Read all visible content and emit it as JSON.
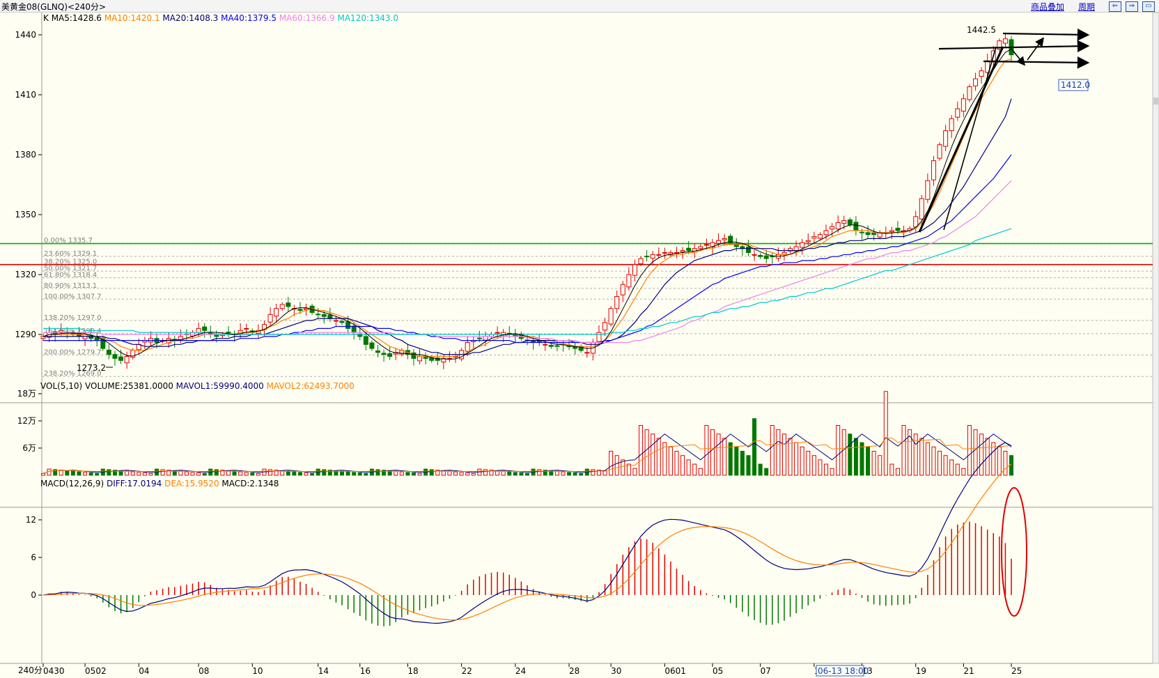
{
  "header": {
    "title": "美黄金08(GLNQ)<240分>",
    "links": [
      "商品叠加",
      "周期"
    ],
    "buttons": [
      "⇐",
      "⇒",
      "▭"
    ]
  },
  "chart_data": [
    {
      "type": "candlestick",
      "panel": "price",
      "legend_prefix": "K",
      "legend": [
        {
          "name": "MA5",
          "value": "1428.6",
          "color": "#000000"
        },
        {
          "name": "MA10",
          "value": "1420.1",
          "color": "#ff8000"
        },
        {
          "name": "MA20",
          "value": "1408.3",
          "color": "#000080"
        },
        {
          "name": "MA40",
          "value": "1379.5",
          "color": "#0000ff"
        },
        {
          "name": "MA60",
          "value": "1366.9",
          "color": "#ee82ee"
        },
        {
          "name": "MA120",
          "value": "1343.0",
          "color": "#00c8d0"
        }
      ],
      "y_ticks": [
        1440,
        1410,
        1380,
        1350,
        1320,
        1290
      ],
      "ylim": [
        1255,
        1451
      ],
      "price_label_high": "1442.5",
      "price_label_low": "1273.2",
      "current_price_tag": "1412.0",
      "fib_levels": [
        {
          "label": "0.00% 1335.7",
          "value": 1335.7
        },
        {
          "label": "23.60% 1329.1",
          "value": 1329.1
        },
        {
          "label": "38.20% 1325.0",
          "value": 1325.0
        },
        {
          "label": "50.00% 1321.7",
          "value": 1321.7
        },
        {
          "label": "61.80% 1318.4",
          "value": 1318.4
        },
        {
          "label": "80.90% 1313.1",
          "value": 1313.1
        },
        {
          "label": "100.00% 1307.7",
          "value": 1307.7
        },
        {
          "label": "138.20% 1297.0",
          "value": 1297.0
        },
        {
          "label": "161.80% 1290.4",
          "value": 1290.4
        },
        {
          "label": "200.00% 1279.7",
          "value": 1279.7
        },
        {
          "label": "238.20% 1269.0",
          "value": 1269.0
        }
      ],
      "hlines": [
        {
          "value": 1335.5,
          "color": "#00b000"
        },
        {
          "value": 1325.0,
          "color": "#d00000"
        }
      ],
      "close": [
        1289,
        1291,
        1290,
        1292,
        1291,
        1290,
        1289,
        1290,
        1288,
        1287,
        1283,
        1280,
        1278,
        1277,
        1279,
        1282,
        1285,
        1287,
        1288,
        1286,
        1287,
        1288,
        1287,
        1289,
        1290,
        1291,
        1293,
        1292,
        1290,
        1289,
        1290,
        1291,
        1290,
        1292,
        1293,
        1291,
        1292,
        1295,
        1300,
        1303,
        1305,
        1304,
        1303,
        1302,
        1303,
        1301,
        1300,
        1299,
        1298,
        1297,
        1296,
        1293,
        1291,
        1289,
        1285,
        1283,
        1281,
        1280,
        1279,
        1281,
        1282,
        1280,
        1278,
        1279,
        1278,
        1277,
        1277,
        1278,
        1278,
        1279,
        1282,
        1286,
        1287,
        1288,
        1289,
        1290,
        1291,
        1291,
        1290,
        1289,
        1288,
        1287,
        1286,
        1286,
        1285,
        1284,
        1284,
        1285,
        1284,
        1283,
        1282,
        1281,
        1286,
        1291,
        1296,
        1303,
        1309,
        1315,
        1320,
        1325,
        1328,
        1329,
        1330,
        1330,
        1331,
        1331,
        1331,
        1332,
        1332,
        1333,
        1334,
        1335,
        1336,
        1337,
        1338,
        1336,
        1334,
        1333,
        1331,
        1330,
        1329,
        1328,
        1329,
        1330,
        1331,
        1333,
        1334,
        1336,
        1337,
        1339,
        1340,
        1342,
        1344,
        1346,
        1347,
        1345,
        1342,
        1341,
        1340,
        1340,
        1341,
        1341,
        1342,
        1342,
        1342,
        1343,
        1349,
        1358,
        1367,
        1377,
        1385,
        1392,
        1398,
        1403,
        1408,
        1414,
        1418,
        1422,
        1427,
        1432,
        1437,
        1438,
        1430
      ],
      "ma10": [
        1289,
        1290,
        1290,
        1290,
        1290,
        1290,
        1290,
        1290,
        1289,
        1289,
        1288,
        1287,
        1286,
        1284,
        1283,
        1282,
        1282,
        1282,
        1283,
        1284,
        1285,
        1286,
        1287,
        1287,
        1288,
        1288,
        1289,
        1290,
        1290,
        1290,
        1290,
        1290,
        1290,
        1291,
        1291,
        1291,
        1292,
        1292,
        1294,
        1295,
        1297,
        1298,
        1300,
        1301,
        1302,
        1303,
        1302,
        1302,
        1301,
        1300,
        1299,
        1298,
        1296,
        1294,
        1292,
        1290,
        1288,
        1286,
        1284,
        1283,
        1282,
        1281,
        1280,
        1279,
        1279,
        1279,
        1279,
        1279,
        1279,
        1279,
        1280,
        1281,
        1283,
        1284,
        1285,
        1287,
        1288,
        1289,
        1290,
        1290,
        1289,
        1289,
        1289,
        1288,
        1288,
        1287,
        1286,
        1285,
        1285,
        1284,
        1284,
        1284,
        1284,
        1285,
        1287,
        1290,
        1294,
        1298,
        1303,
        1308,
        1313,
        1318,
        1322,
        1325,
        1327,
        1329,
        1330,
        1330,
        1331,
        1331,
        1332,
        1333,
        1333,
        1334,
        1335,
        1335,
        1335,
        1335,
        1335,
        1334,
        1333,
        1332,
        1331,
        1330,
        1330,
        1330,
        1331,
        1332,
        1333,
        1334,
        1335,
        1337,
        1339,
        1340,
        1341,
        1342,
        1342,
        1342,
        1342,
        1341,
        1341,
        1341,
        1341,
        1341,
        1341,
        1342,
        1343,
        1346,
        1350,
        1355,
        1361,
        1368,
        1375,
        1382,
        1389,
        1396,
        1402,
        1408,
        1413,
        1418,
        1423,
        1427,
        1428
      ],
      "ma20": [
        1289,
        1289,
        1289,
        1289,
        1289,
        1289,
        1289,
        1289,
        1289,
        1289,
        1289,
        1288,
        1288,
        1287,
        1286,
        1285,
        1285,
        1284,
        1284,
        1284,
        1284,
        1284,
        1285,
        1285,
        1286,
        1286,
        1287,
        1287,
        1287,
        1288,
        1288,
        1288,
        1289,
        1289,
        1289,
        1290,
        1290,
        1290,
        1291,
        1292,
        1293,
        1294,
        1295,
        1296,
        1297,
        1297,
        1298,
        1298,
        1298,
        1298,
        1298,
        1298,
        1297,
        1296,
        1295,
        1294,
        1292,
        1291,
        1290,
        1288,
        1287,
        1285,
        1284,
        1283,
        1282,
        1281,
        1281,
        1280,
        1280,
        1280,
        1280,
        1280,
        1281,
        1281,
        1282,
        1283,
        1284,
        1285,
        1285,
        1286,
        1286,
        1287,
        1287,
        1287,
        1287,
        1287,
        1287,
        1287,
        1287,
        1286,
        1286,
        1285,
        1285,
        1285,
        1286,
        1287,
        1288,
        1290,
        1293,
        1296,
        1300,
        1303,
        1307,
        1311,
        1315,
        1318,
        1321,
        1323,
        1325,
        1327,
        1328,
        1329,
        1330,
        1331,
        1332,
        1332,
        1333,
        1333,
        1333,
        1333,
        1333,
        1333,
        1333,
        1332,
        1332,
        1332,
        1332,
        1332,
        1333,
        1333,
        1334,
        1334,
        1335,
        1336,
        1336,
        1337,
        1337,
        1337,
        1338,
        1338,
        1338,
        1338,
        1339,
        1339,
        1339,
        1340,
        1341,
        1342,
        1344,
        1346,
        1349,
        1352,
        1356,
        1360,
        1364,
        1369,
        1374,
        1379,
        1384,
        1389,
        1394,
        1399,
        1408
      ],
      "ma40": [
        1287,
        1287,
        1287,
        1287,
        1287,
        1287,
        1287,
        1287,
        1287,
        1287,
        1287,
        1287,
        1287,
        1287,
        1287,
        1287,
        1287,
        1287,
        1287,
        1287,
        1287,
        1287,
        1287,
        1287,
        1287,
        1287,
        1287,
        1287,
        1287,
        1287,
        1287,
        1287,
        1287,
        1288,
        1288,
        1288,
        1288,
        1289,
        1289,
        1289,
        1290,
        1290,
        1291,
        1291,
        1292,
        1292,
        1293,
        1293,
        1293,
        1294,
        1294,
        1294,
        1294,
        1294,
        1294,
        1294,
        1293,
        1293,
        1293,
        1292,
        1292,
        1291,
        1291,
        1290,
        1290,
        1289,
        1289,
        1288,
        1288,
        1288,
        1287,
        1287,
        1287,
        1287,
        1287,
        1287,
        1287,
        1287,
        1287,
        1286,
        1286,
        1286,
        1286,
        1286,
        1286,
        1286,
        1286,
        1286,
        1286,
        1286,
        1286,
        1286,
        1286,
        1286,
        1287,
        1287,
        1288,
        1289,
        1290,
        1291,
        1292,
        1294,
        1295,
        1297,
        1299,
        1301,
        1303,
        1305,
        1307,
        1309,
        1311,
        1313,
        1315,
        1316,
        1318,
        1319,
        1320,
        1321,
        1322,
        1323,
        1324,
        1324,
        1325,
        1325,
        1326,
        1326,
        1326,
        1327,
        1327,
        1327,
        1328,
        1328,
        1329,
        1329,
        1330,
        1330,
        1331,
        1331,
        1332,
        1332,
        1333,
        1333,
        1334,
        1334,
        1335,
        1336,
        1337,
        1338,
        1339,
        1341,
        1343,
        1345,
        1347,
        1350,
        1353,
        1356,
        1359,
        1362,
        1365,
        1368,
        1372,
        1376,
        1380
      ],
      "ma60": [
        1291,
        1291,
        1291,
        1291,
        1291,
        1291,
        1291,
        1291,
        1291,
        1291,
        1290,
        1290,
        1290,
        1290,
        1290,
        1290,
        1290,
        1290,
        1290,
        1290,
        1290,
        1290,
        1290,
        1290,
        1290,
        1290,
        1290,
        1290,
        1290,
        1290,
        1290,
        1290,
        1290,
        1290,
        1290,
        1290,
        1290,
        1290,
        1290,
        1290,
        1290,
        1290,
        1290,
        1291,
        1291,
        1291,
        1291,
        1291,
        1291,
        1291,
        1291,
        1291,
        1291,
        1291,
        1291,
        1291,
        1291,
        1291,
        1291,
        1290,
        1290,
        1290,
        1290,
        1290,
        1290,
        1290,
        1289,
        1289,
        1289,
        1289,
        1289,
        1289,
        1289,
        1289,
        1289,
        1289,
        1289,
        1289,
        1289,
        1289,
        1289,
        1288,
        1288,
        1288,
        1288,
        1288,
        1287,
        1287,
        1287,
        1287,
        1286,
        1286,
        1286,
        1286,
        1286,
        1286,
        1286,
        1286,
        1286,
        1287,
        1287,
        1288,
        1289,
        1290,
        1291,
        1292,
        1293,
        1294,
        1296,
        1297,
        1298,
        1300,
        1301,
        1302,
        1304,
        1305,
        1306,
        1307,
        1308,
        1309,
        1310,
        1311,
        1312,
        1313,
        1314,
        1315,
        1316,
        1317,
        1318,
        1319,
        1320,
        1321,
        1322,
        1323,
        1324,
        1325,
        1326,
        1327,
        1328,
        1328,
        1329,
        1330,
        1331,
        1331,
        1332,
        1332,
        1333,
        1334,
        1335,
        1336,
        1338,
        1339,
        1341,
        1343,
        1345,
        1347,
        1349,
        1352,
        1355,
        1358,
        1361,
        1364,
        1367
      ],
      "ma120": [
        1293,
        1293,
        1293,
        1293,
        1293,
        1293,
        1293,
        1292,
        1292,
        1292,
        1292,
        1292,
        1292,
        1292,
        1292,
        1292,
        1291,
        1291,
        1291,
        1291,
        1291,
        1291,
        1291,
        1291,
        1291,
        1291,
        1291,
        1291,
        1291,
        1290,
        1290,
        1290,
        1290,
        1290,
        1290,
        1290,
        1290,
        1290,
        1290,
        1290,
        1290,
        1290,
        1290,
        1290,
        1290,
        1290,
        1290,
        1290,
        1290,
        1290,
        1290,
        1290,
        1290,
        1290,
        1290,
        1290,
        1290,
        1290,
        1290,
        1290,
        1290,
        1290,
        1290,
        1290,
        1290,
        1290,
        1290,
        1290,
        1290,
        1290,
        1290,
        1290,
        1290,
        1290,
        1290,
        1290,
        1290,
        1290,
        1290,
        1290,
        1290,
        1290,
        1290,
        1290,
        1290,
        1290,
        1290,
        1290,
        1290,
        1290,
        1290,
        1290,
        1290,
        1290,
        1290,
        1291,
        1291,
        1291,
        1292,
        1292,
        1293,
        1293,
        1294,
        1294,
        1295,
        1296,
        1296,
        1297,
        1298,
        1299,
        1299,
        1300,
        1301,
        1301,
        1302,
        1303,
        1303,
        1304,
        1304,
        1305,
        1306,
        1306,
        1307,
        1307,
        1308,
        1309,
        1309,
        1310,
        1311,
        1311,
        1312,
        1313,
        1313,
        1314,
        1315,
        1316,
        1317,
        1318,
        1319,
        1320,
        1321,
        1322,
        1322,
        1323,
        1324,
        1325,
        1326,
        1327,
        1328,
        1329,
        1330,
        1331,
        1332,
        1333,
        1334,
        1335,
        1337,
        1338,
        1339,
        1340,
        1341,
        1342,
        1343
      ]
    },
    {
      "type": "bar",
      "panel": "volume",
      "legend": [
        {
          "name": "VOL(5,10)",
          "value": "",
          "color": "#000000"
        },
        {
          "name": "VOLUME",
          "value": "25381.0000",
          "color": "#000000"
        },
        {
          "name": "MAVOL1",
          "value": "59990.4000",
          "color": "#000080"
        },
        {
          "name": "MAVOL2",
          "value": "62493.7000",
          "color": "#ff8000"
        }
      ],
      "y_ticks": [
        "18万",
        "12万",
        "6万"
      ],
      "y_tick_values": [
        180000,
        120000,
        60000
      ],
      "ylim": [
        0,
        195000
      ]
    },
    {
      "type": "bar",
      "panel": "macd",
      "legend": [
        {
          "name": "MACD(12,26,9)",
          "value": "",
          "color": "#000000"
        },
        {
          "name": "DIFF",
          "value": "17.0194",
          "color": "#000080"
        },
        {
          "name": "DEA",
          "value": "15.9520",
          "color": "#ff8000"
        },
        {
          "name": "MACD",
          "value": "2.1348",
          "color": "#000000"
        }
      ],
      "y_ticks": [
        12,
        6,
        0
      ],
      "ylim": [
        -6.5,
        19.5
      ]
    }
  ],
  "xaxis": {
    "corner_label": "240分",
    "labels": [
      "0430",
      "0502",
      "04",
      "08",
      "10",
      "14",
      "16",
      "18",
      "22",
      "24",
      "28",
      "30",
      "0601",
      "05",
      "07",
      "11",
      "13",
      "19",
      "21",
      "25"
    ],
    "cursor_label": "06-13 18:00"
  }
}
